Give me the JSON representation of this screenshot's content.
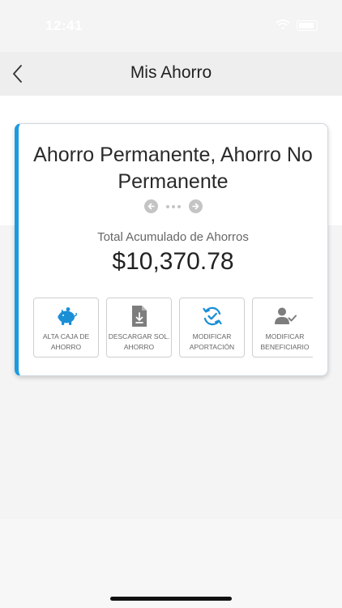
{
  "status": {
    "time": "12:41"
  },
  "nav": {
    "title": "Mis Ahorro"
  },
  "card": {
    "title": "Ahorro Permanente, Ahorro No Permanente",
    "accent_color": "#1a9be0",
    "total_label": "Total Acumulado de Ahorros",
    "total_amount": "$10,370.78"
  },
  "actions": [
    {
      "icon": "piggy-bank-icon",
      "label_line1": "ALTA CAJA DE",
      "label_line2": "AHORRO"
    },
    {
      "icon": "download-document-icon",
      "label_line1": "DESCARGAR SOL.",
      "label_line2": "AHORRO"
    },
    {
      "icon": "refresh-check-icon",
      "label_line1": "MODIFICAR",
      "label_line2": "APORTACIÓN"
    },
    {
      "icon": "user-check-icon",
      "label_line1": "MODIFICAR",
      "label_line2": "BENEFICIARIO"
    }
  ]
}
